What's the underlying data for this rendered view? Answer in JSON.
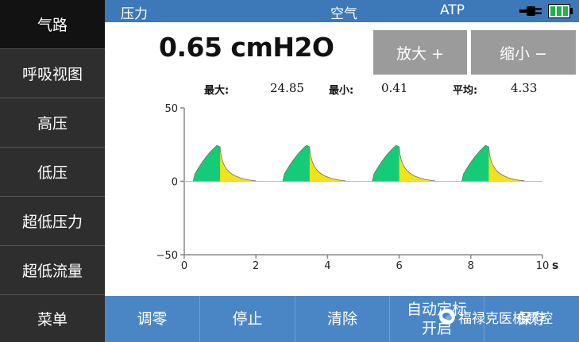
{
  "sidebar": {
    "items": [
      {
        "label": "气路",
        "active": true
      },
      {
        "label": "呼吸视图"
      },
      {
        "label": "高压"
      },
      {
        "label": "低压"
      },
      {
        "label": "超低压力"
      },
      {
        "label": "超低流量"
      },
      {
        "label": "菜单"
      }
    ]
  },
  "status_bar": {
    "measure": "压力",
    "gas": "空气",
    "condition": "ATP",
    "icons": [
      "power-plug-icon",
      "battery-icon"
    ]
  },
  "reading": {
    "value": "0.65 cmH2O"
  },
  "zoom": {
    "zoom_in": "放大 +",
    "zoom_out": "缩小 −"
  },
  "stats": {
    "max_label": "最大:",
    "max_value": "24.85",
    "min_label": "最小:",
    "min_value": "0.41",
    "avg_label": "平均:",
    "avg_value": "4.33"
  },
  "chart_data": {
    "type": "area",
    "x_unit": "s",
    "xlim": [
      0,
      10
    ],
    "ylim": [
      -50,
      50
    ],
    "x_ticks": [
      "0",
      "2",
      "4",
      "6",
      "8",
      "10"
    ],
    "y_ticks": [
      "50",
      "0",
      "−50"
    ],
    "grid": false,
    "cycles": [
      {
        "start": 0.25,
        "peak_time": 1.0,
        "peak": 24.5,
        "end": 2.0
      },
      {
        "start": 2.75,
        "peak_time": 3.5,
        "peak": 24.5,
        "end": 4.5
      },
      {
        "start": 5.25,
        "peak_time": 6.0,
        "peak": 24.5,
        "end": 7.0
      },
      {
        "start": 7.75,
        "peak_time": 8.5,
        "peak": 24.5,
        "end": 9.5
      }
    ],
    "colors": {
      "rise": "#14cc78",
      "decay": "#f2e21a",
      "axis": "#888888"
    }
  },
  "toolbar": {
    "buttons": [
      "调零",
      "停止",
      "清除",
      "自动定标\n开启",
      "保存"
    ]
  },
  "watermark": {
    "text": "福禄克医械质控"
  }
}
